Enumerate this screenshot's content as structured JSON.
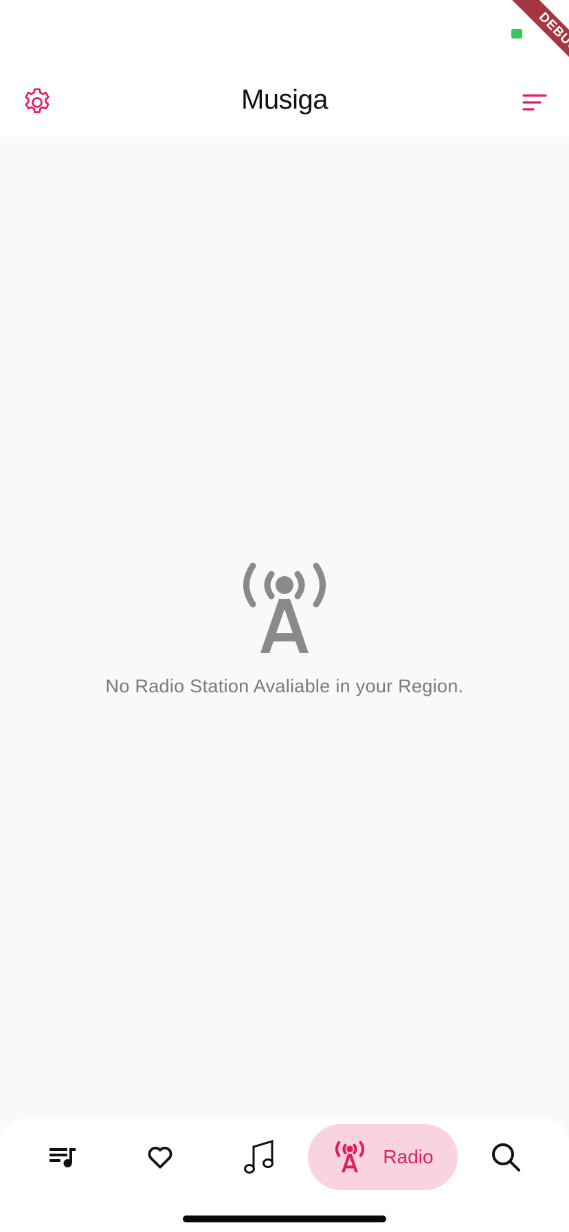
{
  "app_bar": {
    "title": "Musiga",
    "settings_icon": "gear-icon",
    "sort_icon": "sort-lines-icon"
  },
  "debug_banner": {
    "label": "DEBUG"
  },
  "empty_state": {
    "icon": "radio-tower-icon",
    "message": "No Radio Station Avaliable in your Region."
  },
  "bottom_nav": {
    "items": [
      {
        "id": "queue",
        "icon": "queue-music-icon",
        "selected": false
      },
      {
        "id": "favorites",
        "icon": "heart-icon",
        "selected": false
      },
      {
        "id": "songs",
        "icon": "music-note-icon",
        "selected": false
      },
      {
        "id": "radio",
        "icon": "radio-tower-icon",
        "label": "Radio",
        "selected": true
      },
      {
        "id": "search",
        "icon": "search-icon",
        "selected": false
      }
    ]
  },
  "colors": {
    "accent": "#e31c5f",
    "accent_soft": "#f9d4e0",
    "background": "#f9f9f9",
    "empty_icon": "#8a8a8a",
    "empty_text": "#7a7a7a",
    "debug_ribbon": "#a4363f",
    "battery": "#34c759"
  }
}
